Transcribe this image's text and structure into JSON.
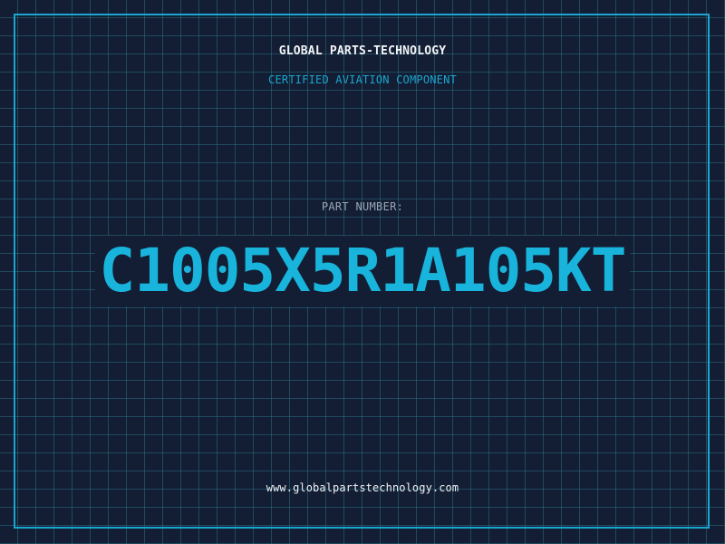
{
  "header": {
    "brand": "GLOBAL PARTS-TECHNOLOGY",
    "tagline": "CERTIFIED AVIATION COMPONENT"
  },
  "part": {
    "label": "PART NUMBER:",
    "value": "C1005X5R1A105KT"
  },
  "footer": {
    "url": "www.globalpartstechnology.com"
  },
  "colors": {
    "background": "#131d33",
    "grid": "#286e82",
    "accent": "#1aa6cf",
    "part_number": "#18b4dc",
    "text_light": "#f2f5f8",
    "text_muted": "#9aa7b6"
  }
}
